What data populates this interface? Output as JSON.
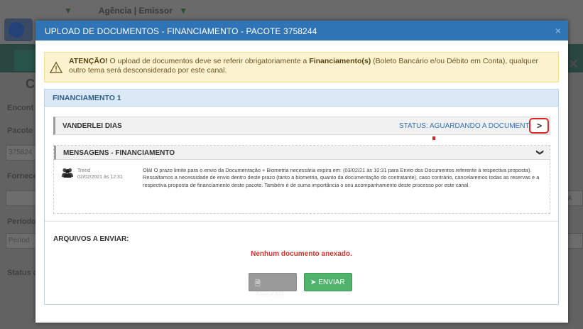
{
  "background": {
    "topnav": "Agência | Emissor",
    "heading_initial": "C",
    "labels": [
      "Encont",
      "Pacote",
      "Fornece",
      "Período",
      "Status d"
    ],
    "field_values": [
      "375824",
      "",
      "Períod"
    ],
    "right_text": "RA"
  },
  "modal": {
    "title": "UPLOAD DE DOCUMENTOS - FINANCIAMENTO - PACOTE 3758244",
    "close_label": "×",
    "alert": {
      "prefix": "ATENÇÃO!",
      "text_1": " O upload de documentos deve se referir obrigatoriamente a ",
      "bold": "Financiamento(s)",
      "text_2": " (Boleto Bancário e/ou Débito em Conta), qualquer outro tema será desconsiderado por este canal."
    },
    "financing": {
      "header": "FINANCIAMENTO 1",
      "person_name": "VANDERLEI DIAS",
      "status": "STATUS: AGUARDANDO A DOCUMENTAÇÃO",
      "expand_label": ">",
      "messages": {
        "header": "MENSAGENS - FINANCIAMENTO",
        "chevron": "❯",
        "user": "Trend",
        "timestamp": "02/02/2021 às 12:31",
        "text": "Olá! O prazo limite para o envio da Documentação + Biometria necessária expira em: (03/02/21 às 10:31 para Envio dos Documentos referente à respectiva proposta). Ressaltamos a necessidade de envio dentro deste prazo (tanto a biometria, quanto da documentação do contratante), caso contrário, cancelaremos todas as reservas e a respectiva proposta de financiamento deste pacote. Também é de suma importância o seu acompanhamento deste processo por este canal."
      },
      "files_label": "ARQUIVOS A ENVIAR:",
      "no_documents": "Nenhum documento anexado.",
      "attach_label": "ANEXAR",
      "send_label": "ENVIAR"
    }
  },
  "colors": {
    "header_blue": "#2f74b5",
    "alert_bg": "#fdf2d0",
    "error_red": "#d0342c",
    "send_green": "#4fb36c",
    "highlight_red": "#e0242b"
  }
}
